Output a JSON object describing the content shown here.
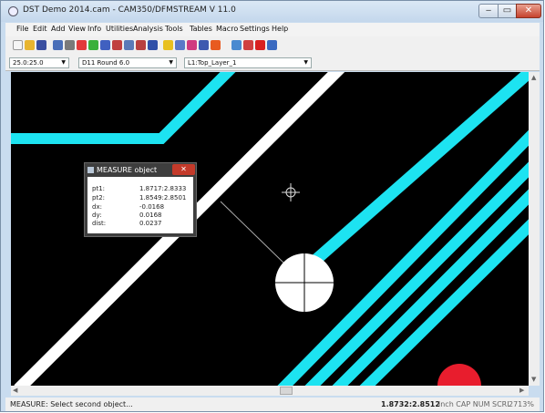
{
  "window": {
    "title": "DST Demo 2014.cam - CAM350/DFMSTREAM V 11.0",
    "min_glyph": "‒",
    "max_glyph": "▭",
    "close_glyph": "✕"
  },
  "menu": [
    "File",
    "Edit",
    "Add",
    "View",
    "Info",
    "Utilities",
    "Analysis",
    "Tools",
    "Tables",
    "Macro",
    "Settings",
    "Help"
  ],
  "toolbar_icons": [
    "new-icon",
    "open-icon",
    "save-icon",
    "undo-icon",
    "redo-icon",
    "zoom-in-icon",
    "zoom-out-icon",
    "pan-icon",
    "window-icon",
    "redraw-icon",
    "layers-icon",
    "grid-icon",
    "snap-icon",
    "display-icon",
    "color-icon",
    "measure-icon",
    "select-icon",
    "copy-icon",
    "delete-icon",
    "rotate-icon",
    "query-icon"
  ],
  "combos": {
    "grid": "25.0:25.0",
    "dcode": "D11  Round 6.0",
    "layer": "L1:Top_Layer_1"
  },
  "measure_dialog": {
    "title": "MEASURE object",
    "close_glyph": "✕",
    "rows": [
      {
        "label": "pt1:",
        "value": "1.8717:2.8333"
      },
      {
        "label": "pt2:",
        "value": "1.8549:2.8501"
      },
      {
        "label": "dx:",
        "value": "-0.0168"
      },
      {
        "label": "dy:",
        "value": "0.0168"
      },
      {
        "label": "dist:",
        "value": "0.0237"
      }
    ]
  },
  "status": {
    "message": "MEASURE: Select second object...",
    "coordinates": "1.8732:2.8512",
    "units": "inch  CAP  NUM  SCRL",
    "zoom": "2713%"
  },
  "colors": {
    "trace_cyan": "#1de3f1",
    "trace_white": "#ffffff",
    "canvas_bg": "#000000",
    "pad_red": "#e81d2d"
  }
}
